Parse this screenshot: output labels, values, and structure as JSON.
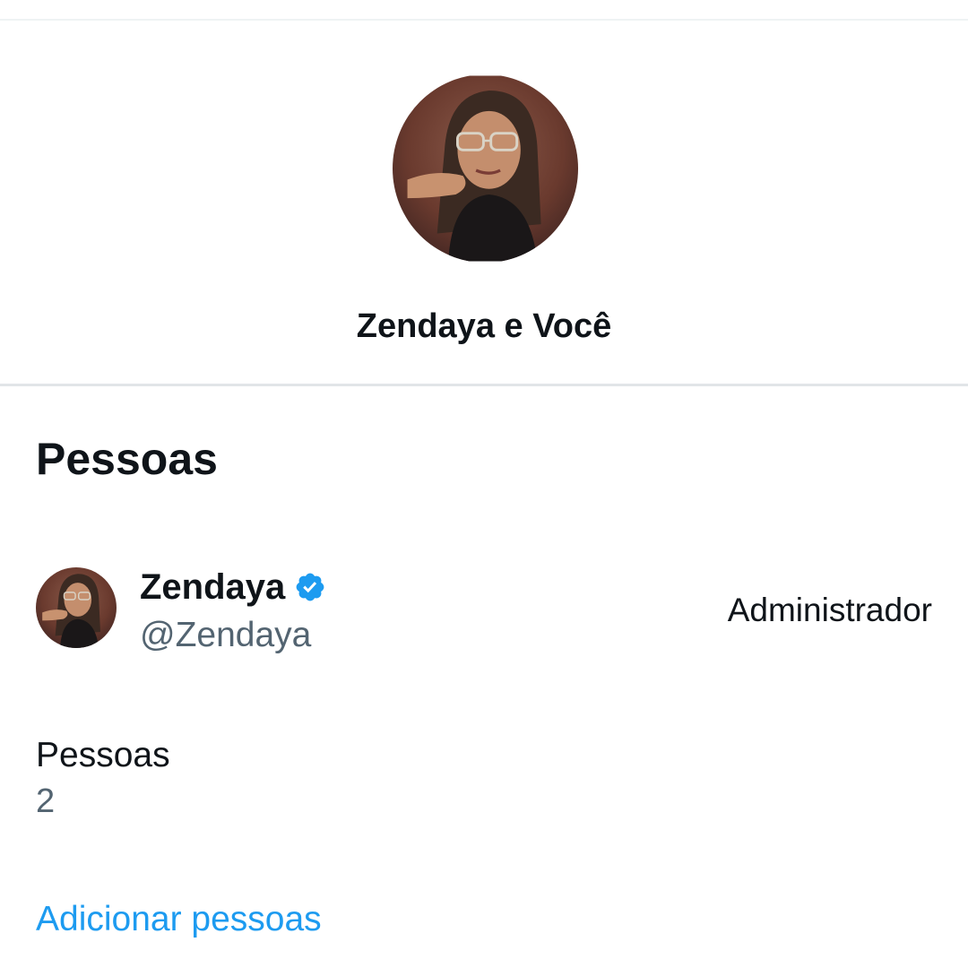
{
  "header": {
    "group_name": "Zendaya e Você",
    "group_avatar_icon": "person-photo-avatar"
  },
  "people_section": {
    "title": "Pessoas",
    "members": [
      {
        "name": "Zendaya",
        "handle": "@Zendaya",
        "role": "Administrador",
        "verified": true,
        "avatar_icon": "person-photo-avatar"
      }
    ],
    "count_label": "Pessoas",
    "count_value": "2",
    "add_label": "Adicionar pessoas"
  },
  "colors": {
    "accent": "#1d9bf0",
    "text_primary": "#0f1419",
    "text_secondary": "#536471",
    "divider": "#eff3f4"
  }
}
